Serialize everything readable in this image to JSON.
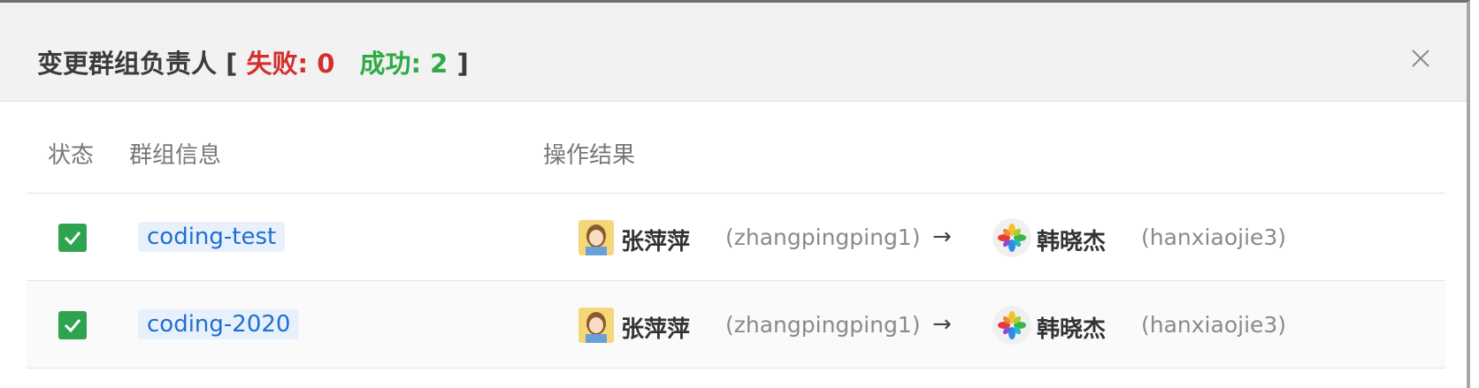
{
  "dialog": {
    "title": "变更群组负责人",
    "bracket_open": "[",
    "fail_label": "失败: 0",
    "success_label": "成功: 2",
    "bracket_close": "]"
  },
  "table": {
    "headers": {
      "status": "状态",
      "group_info": "群组信息",
      "result": "操作结果"
    },
    "rows": [
      {
        "status": "success",
        "group": "coding-test",
        "from_name": "张萍萍",
        "from_user": "(zhangpingping1)",
        "arrow": "→",
        "to_name": "韩晓杰",
        "to_user": "(hanxiaojie3)"
      },
      {
        "status": "success",
        "group": "coding-2020",
        "from_name": "张萍萍",
        "from_user": "(zhangpingping1)",
        "arrow": "→",
        "to_name": "韩晓杰",
        "to_user": "(hanxiaojie3)"
      }
    ]
  },
  "colors": {
    "fail": "#d42e2e",
    "success": "#2faa45",
    "checkbox": "#2ea44f",
    "tag_text": "#1f6fd1",
    "tag_bg": "#e8f1fb"
  },
  "icons": {
    "close": "close-icon",
    "check": "check-icon",
    "arrow": "arrow-right-icon"
  }
}
